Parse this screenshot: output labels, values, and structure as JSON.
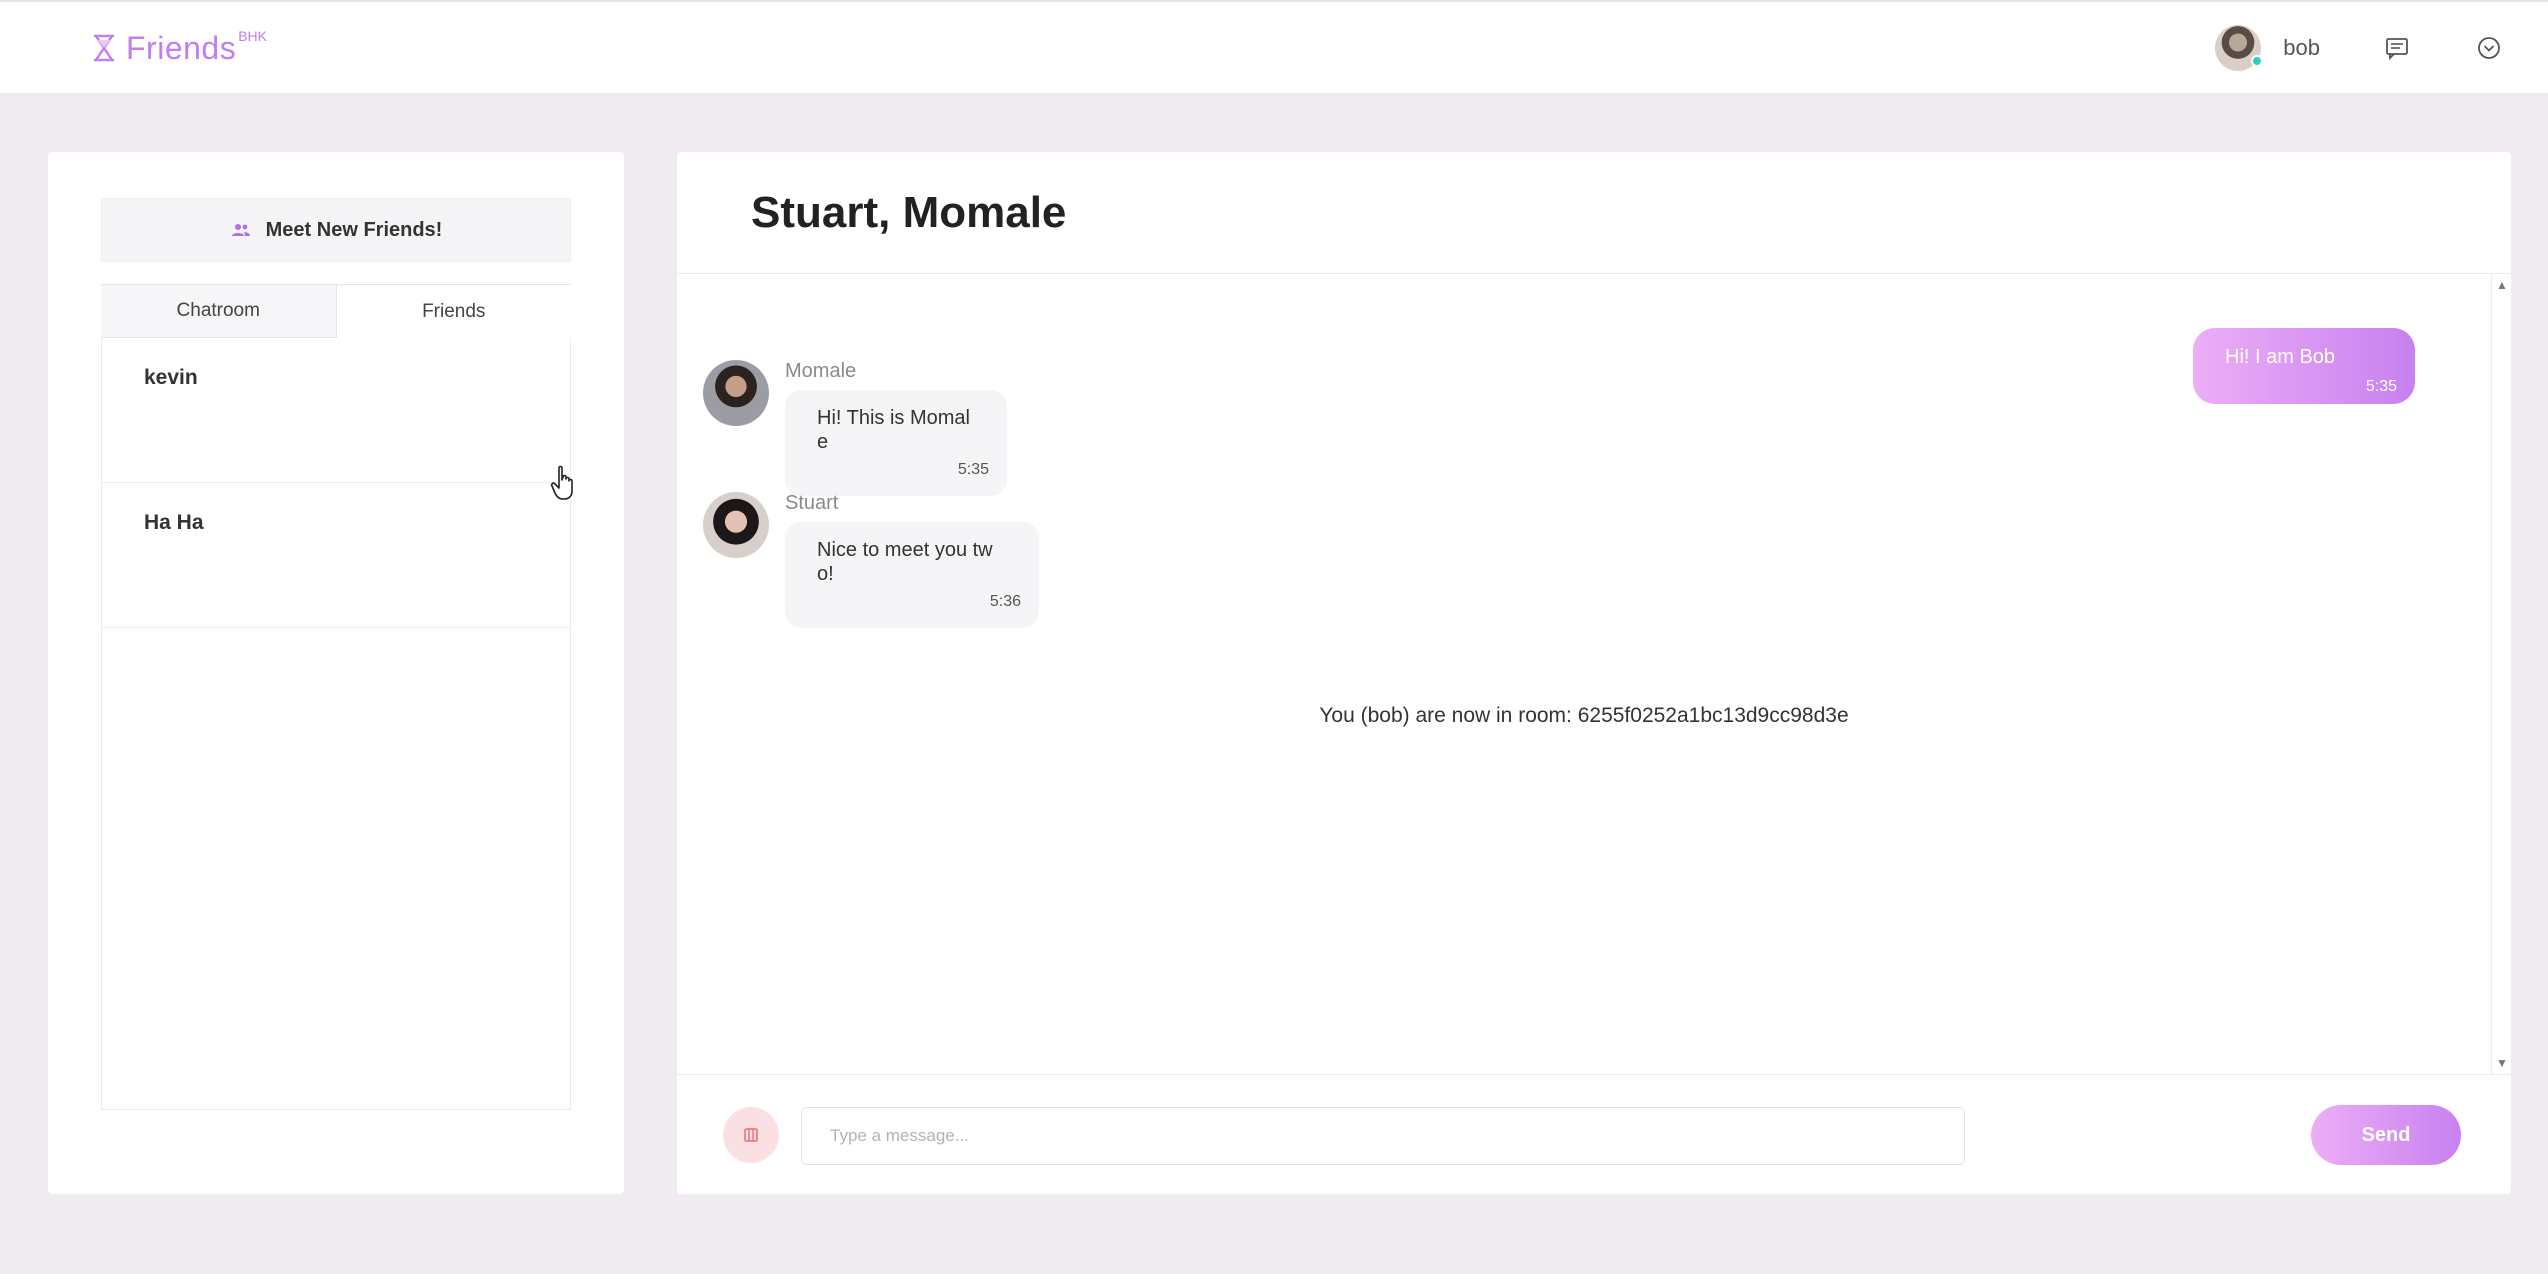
{
  "brand": {
    "name": "Friends",
    "sup": "BHK"
  },
  "navbar": {
    "username": "bob",
    "icons": [
      "chat-icon",
      "dropdown-icon"
    ]
  },
  "sidebar": {
    "meet_button": "Meet New Friends!",
    "tabs": [
      {
        "label": "Chatroom",
        "active": false
      },
      {
        "label": "Friends",
        "active": true
      }
    ],
    "friends": [
      {
        "name": "kevin"
      },
      {
        "name": "Ha Ha"
      }
    ]
  },
  "chat": {
    "title": "Stuart, Momale",
    "messages": [
      {
        "sender": "",
        "text": "Hi! I am Bob",
        "time": "5:35",
        "outgoing": true
      },
      {
        "sender": "Momale",
        "text_lines": [
          "Hi! This is Momal",
          "e"
        ],
        "time": "5:35",
        "outgoing": false
      },
      {
        "sender": "Stuart",
        "text_lines": [
          "Nice to meet you tw",
          "o!"
        ],
        "time": "5:36",
        "outgoing": false
      }
    ],
    "system_message": "You (bob) are now in room: 6255f0252a1bc13d9cc98d3e"
  },
  "composer": {
    "placeholder": "Type a message...",
    "send_label": "Send"
  },
  "colors": {
    "accent": "#c781f0",
    "accent_light": "#ecaef6",
    "background": "#f0ebf1",
    "online": "#2ccfb8"
  }
}
